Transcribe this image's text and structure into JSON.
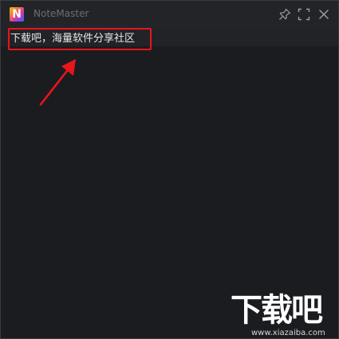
{
  "window": {
    "app_name": "NoteMaster",
    "logo_letter": "N"
  },
  "toolbar": {
    "icons": [
      "pin-icon",
      "maximize-icon",
      "close-icon"
    ]
  },
  "note": {
    "text": "下载吧，海量软件分享社区"
  },
  "annotation": {
    "highlight_color": "#e8151b",
    "arrow_color": "#e8151b"
  },
  "watermark": {
    "logo_text": "下载吧",
    "url": "www.xiazaiba.com"
  },
  "colors": {
    "background": "#1b1c20",
    "titlebar": "#232428",
    "text": "#e6e6e6"
  }
}
